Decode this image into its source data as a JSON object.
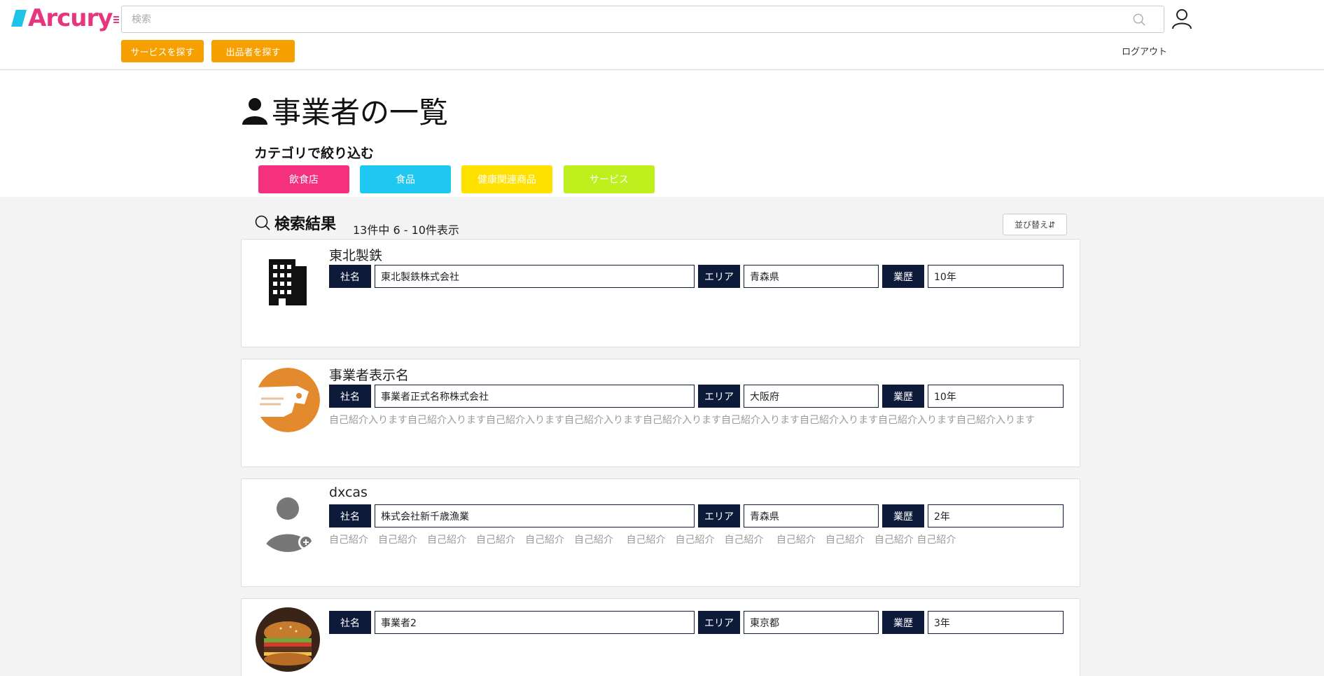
{
  "header": {
    "logo_text": "Arcury",
    "search_placeholder": "検索",
    "buttons": [
      "サービスを探す",
      "出品者を探す"
    ],
    "logout": "ログアウト",
    "accent": "#f5a000"
  },
  "page": {
    "title": "事業者の一覧",
    "filter_label": "カテゴリで絞り込む",
    "categories": [
      {
        "label": "飲食店",
        "color": "#f5317f"
      },
      {
        "label": "食品",
        "color": "#1ec8f0"
      },
      {
        "label": "健康関連商品",
        "color": "#ffe100"
      },
      {
        "label": "サービス",
        "color": "#bff01e"
      }
    ]
  },
  "results": {
    "title": "検索結果",
    "count": "13件中 6 - 10件表示",
    "sort": "並び替え⇵"
  },
  "labels": {
    "company": "社名",
    "area": "エリア",
    "years": "業歴"
  },
  "cards": [
    {
      "name": "東北製鉄",
      "company": "東北製鉄株式会社",
      "area": "青森県",
      "years": "10年",
      "intro": "",
      "avatar": "building-icon"
    },
    {
      "name": "事業者表示名",
      "company": "事業者正式名称株式会社",
      "area": "大阪府",
      "years": "10年",
      "intro": "自己紹介入ります自己紹介入ります自己紹介入ります自己紹介入ります自己紹介入ります自己紹介入ります自己紹介入ります自己紹介入ります自己紹介入ります",
      "avatar": "orange-logo"
    },
    {
      "name": "dxcas",
      "company": "株式会社新千歳漁業",
      "area": "青森県",
      "years": "2年",
      "intro": "自己紹介　自己紹介　自己紹介　自己紹介　自己紹介　自己紹介　 自己紹介　自己紹介　自己紹介　 自己紹介　自己紹介　自己紹介 自己紹介",
      "avatar": "default-user-icon"
    },
    {
      "name": "",
      "company": "事業者2",
      "area": "東京都",
      "years": "3年",
      "intro": "",
      "avatar": "burger-photo"
    }
  ]
}
